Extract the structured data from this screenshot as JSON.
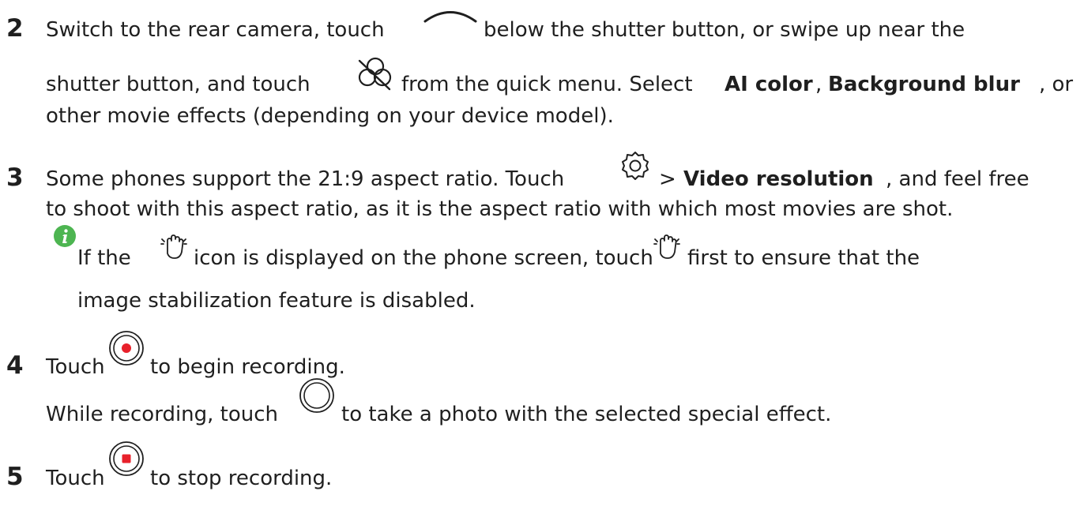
{
  "steps": [
    {
      "number": "2",
      "line1a": "Switch to the rear camera, touch",
      "line1b": "below the shutter button, or swipe up near the",
      "line2a": "shutter button, and touch",
      "line2b": "from the quick menu. Select",
      "bold1": "AI color",
      "sep1": ",",
      "bold2": "Background blur",
      "line2c": ", or",
      "line3": "other movie effects (depending on your device model).",
      "icons": [
        "chevron-up-icon",
        "movie-effects-icon"
      ]
    },
    {
      "number": "3",
      "line1a": "Some phones support the 21:9 aspect ratio. Touch",
      "line1b": ">",
      "bold1": "Video resolution",
      "line1c": ", and feel free",
      "line2": "to shoot with this aspect ratio, as it is the aspect ratio with which most movies are shot.",
      "icons": [
        "settings-icon"
      ],
      "note": {
        "line1a": "If the",
        "line1b": "icon is displayed on the phone screen, touch",
        "line1c": "first to ensure that the",
        "line2": "image stabilization feature is disabled.",
        "icons": [
          "info-icon",
          "stabilization-hand-icon"
        ]
      }
    },
    {
      "number": "4",
      "line1a": "Touch",
      "line1b": "to begin recording.",
      "line2a": "While recording, touch",
      "line2b": "to take a photo with the selected special effect.",
      "icons": [
        "record-button-icon",
        "shutter-button-icon"
      ]
    },
    {
      "number": "5",
      "line1a": "Touch",
      "line1b": "to stop recording.",
      "icons": [
        "stop-button-icon"
      ]
    }
  ],
  "colors": {
    "text": "#1f1f1f",
    "record_red": "#e8212b",
    "info_green": "#4db551",
    "icon_gray": "#8a8a8a"
  }
}
